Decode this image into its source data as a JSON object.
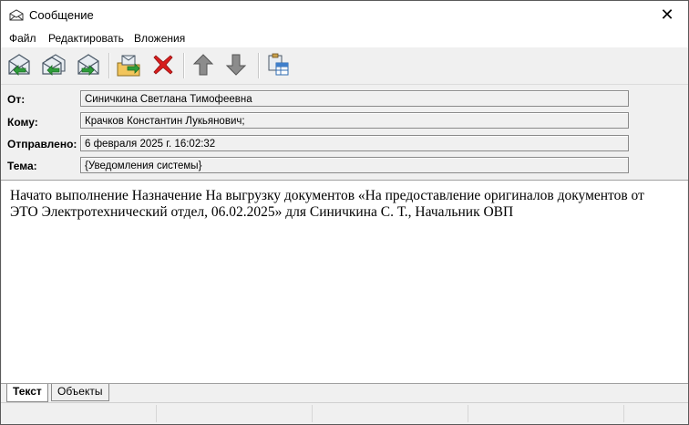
{
  "window": {
    "title": "Сообщение",
    "icon": "envelope-icon",
    "close_glyph": "✕"
  },
  "menu": {
    "items": [
      "Файл",
      "Редактировать",
      "Вложения"
    ]
  },
  "toolbar": {
    "buttons": [
      {
        "name": "reply-button",
        "icon": "envelope-reply-icon"
      },
      {
        "name": "reply-all-button",
        "icon": "envelope-reply-all-icon"
      },
      {
        "name": "forward-button",
        "icon": "envelope-forward-icon"
      },
      {
        "name": "move-to-folder-button",
        "icon": "folder-envelope-icon"
      },
      {
        "name": "delete-button",
        "icon": "delete-icon"
      },
      {
        "name": "previous-message-button",
        "icon": "arrow-up-icon"
      },
      {
        "name": "next-message-button",
        "icon": "arrow-down-icon"
      },
      {
        "name": "properties-button",
        "icon": "clipboard-table-icon"
      }
    ]
  },
  "headers": {
    "from_label": "От:",
    "from_value": "Синичкина Светлана Тимофеевна",
    "to_label": "Кому:",
    "to_value": "Крачков Константин Лукьянович;",
    "sent_label": "Отправлено:",
    "sent_value": "6 февраля 2025 г. 16:02:32",
    "subject_label": "Тема:",
    "subject_value": "{Уведомления системы}"
  },
  "body": {
    "text": "Начато выполнение Назначение На выгрузку документов «На предоставление оригиналов документов от ЭТО Электротехнический отдел, 06.02.2025» для Синичкина С. Т., Начальник ОВП"
  },
  "tabs": {
    "items": [
      "Текст",
      "Объекты"
    ],
    "active": "Текст"
  },
  "colors": {
    "delete_red": "#d81e1e",
    "arrow_gray": "#7a7a7a",
    "envelope_green": "#2e9d3a"
  }
}
